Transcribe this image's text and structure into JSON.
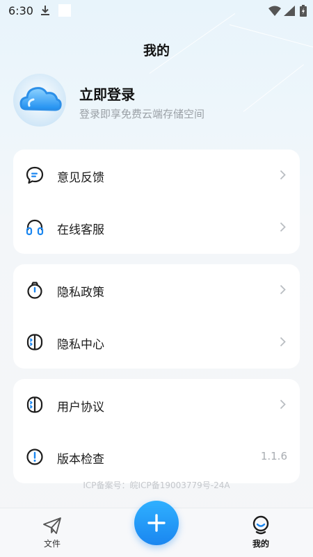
{
  "status_bar": {
    "time": "6:30"
  },
  "header": {
    "title": "我的"
  },
  "profile": {
    "login_title": "立即登录",
    "login_subtitle": "登录即享免费云端存储空间"
  },
  "groups": [
    {
      "items": [
        {
          "label": "意见反馈",
          "icon": "feedback-icon"
        },
        {
          "label": "在线客服",
          "icon": "headset-icon"
        }
      ]
    },
    {
      "items": [
        {
          "label": "隐私政策",
          "icon": "privacy-policy-icon"
        },
        {
          "label": "隐私中心",
          "icon": "privacy-center-icon"
        }
      ]
    },
    {
      "items": [
        {
          "label": "用户协议",
          "icon": "user-agreement-icon"
        },
        {
          "label": "版本检查",
          "icon": "version-check-icon",
          "value": "1.1.6"
        }
      ]
    }
  ],
  "footer": {
    "icp": "ICP备案号：皖ICP备19003779号-24A"
  },
  "tabbar": {
    "files_label": "文件",
    "mine_label": "我的",
    "active": "mine"
  },
  "colors": {
    "accent": "#1a86f0",
    "fab_top": "#2fb0ff",
    "chevron": "#b9bdc2",
    "muted_text": "#9aa0a6"
  }
}
